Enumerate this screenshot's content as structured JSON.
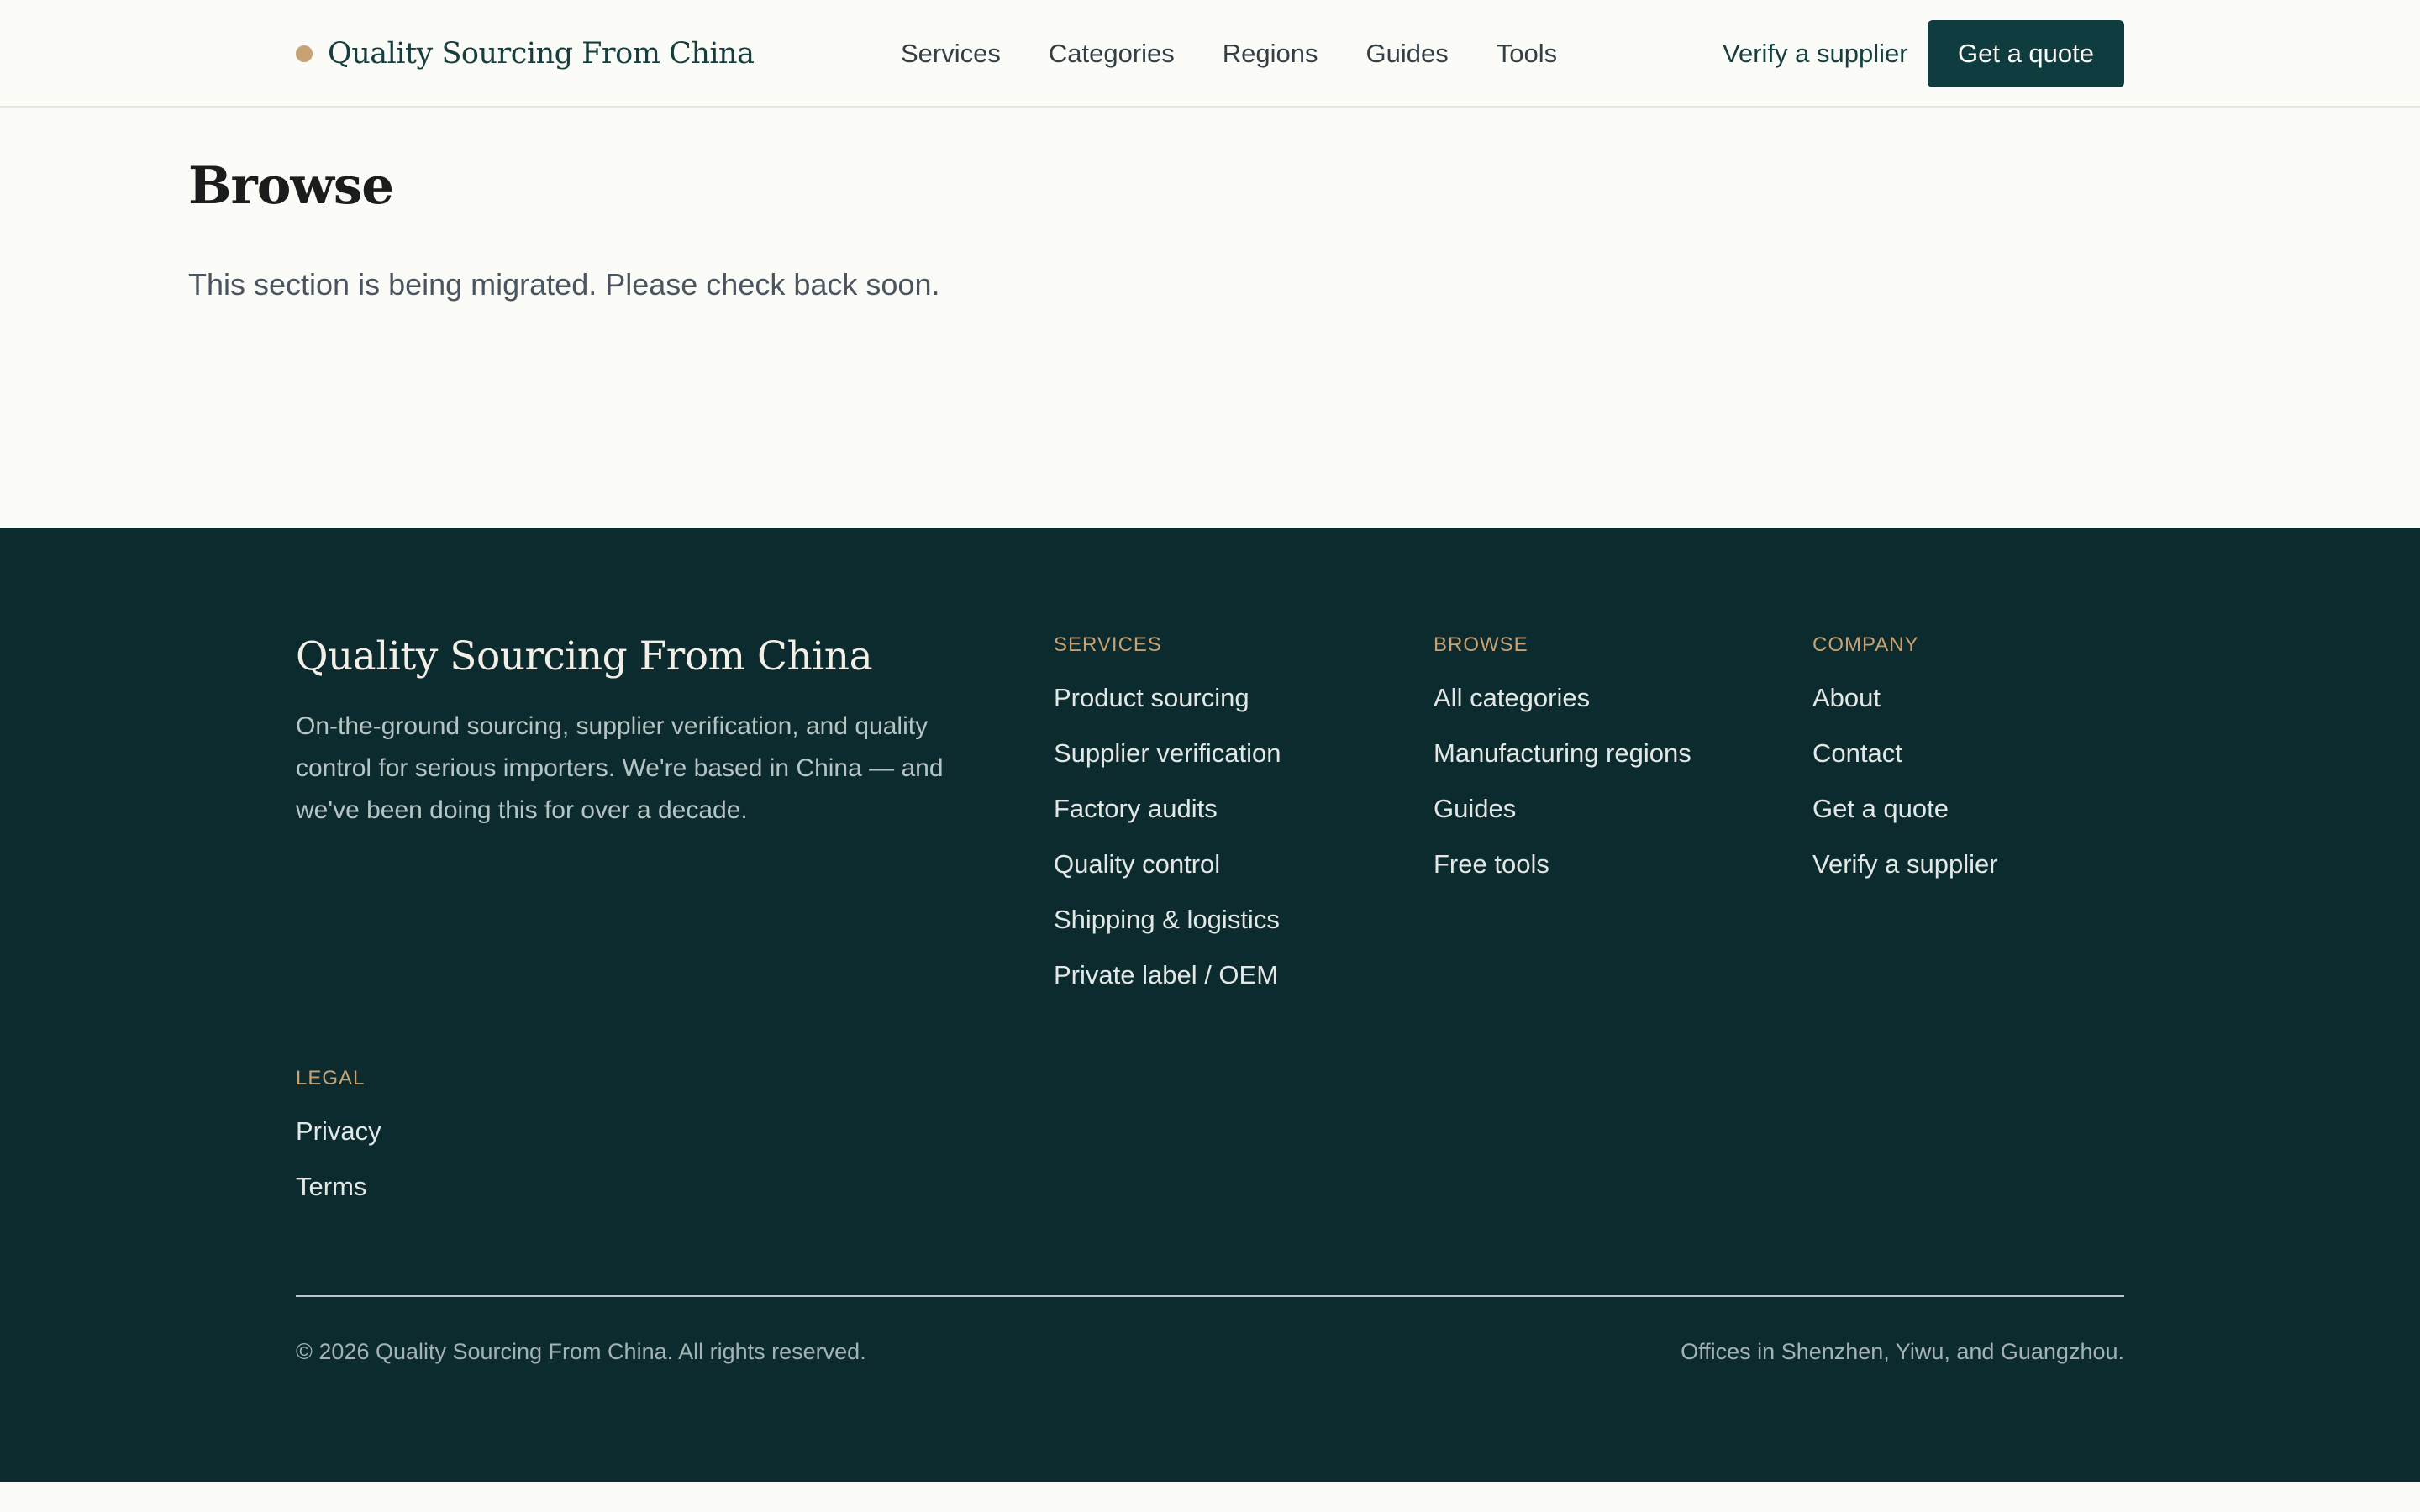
{
  "header": {
    "brand": "Quality Sourcing From China",
    "nav": [
      "Services",
      "Categories",
      "Regions",
      "Guides",
      "Tools"
    ],
    "verify_link": "Verify a supplier",
    "quote_button": "Get a quote"
  },
  "main": {
    "title": "Browse",
    "message": "This section is being migrated. Please check back soon."
  },
  "footer": {
    "brand": "Quality Sourcing From China",
    "description": "On-the-ground sourcing, supplier verification, and quality control for serious importers. We're based in China — and we've been doing this for over a decade.",
    "columns": {
      "services": {
        "heading": "SERVICES",
        "links": [
          "Product sourcing",
          "Supplier verification",
          "Factory audits",
          "Quality control",
          "Shipping & logistics",
          "Private label / OEM"
        ]
      },
      "browse": {
        "heading": "BROWSE",
        "links": [
          "All categories",
          "Manufacturing regions",
          "Guides",
          "Free tools"
        ]
      },
      "company": {
        "heading": "COMPANY",
        "links": [
          "About",
          "Contact",
          "Get a quote",
          "Verify a supplier"
        ]
      },
      "legal": {
        "heading": "LEGAL",
        "links": [
          "Privacy",
          "Terms"
        ]
      }
    },
    "copyright": "© 2026 Quality Sourcing From China. All rights reserved.",
    "offices": "Offices in Shenzhen, Yiwu, and Guangzhou."
  },
  "colors": {
    "page_background": "#fbfbf7",
    "brand_dark": "#0f3d3f",
    "footer_background": "#0c2b2e",
    "accent_gold": "#c9a172"
  }
}
